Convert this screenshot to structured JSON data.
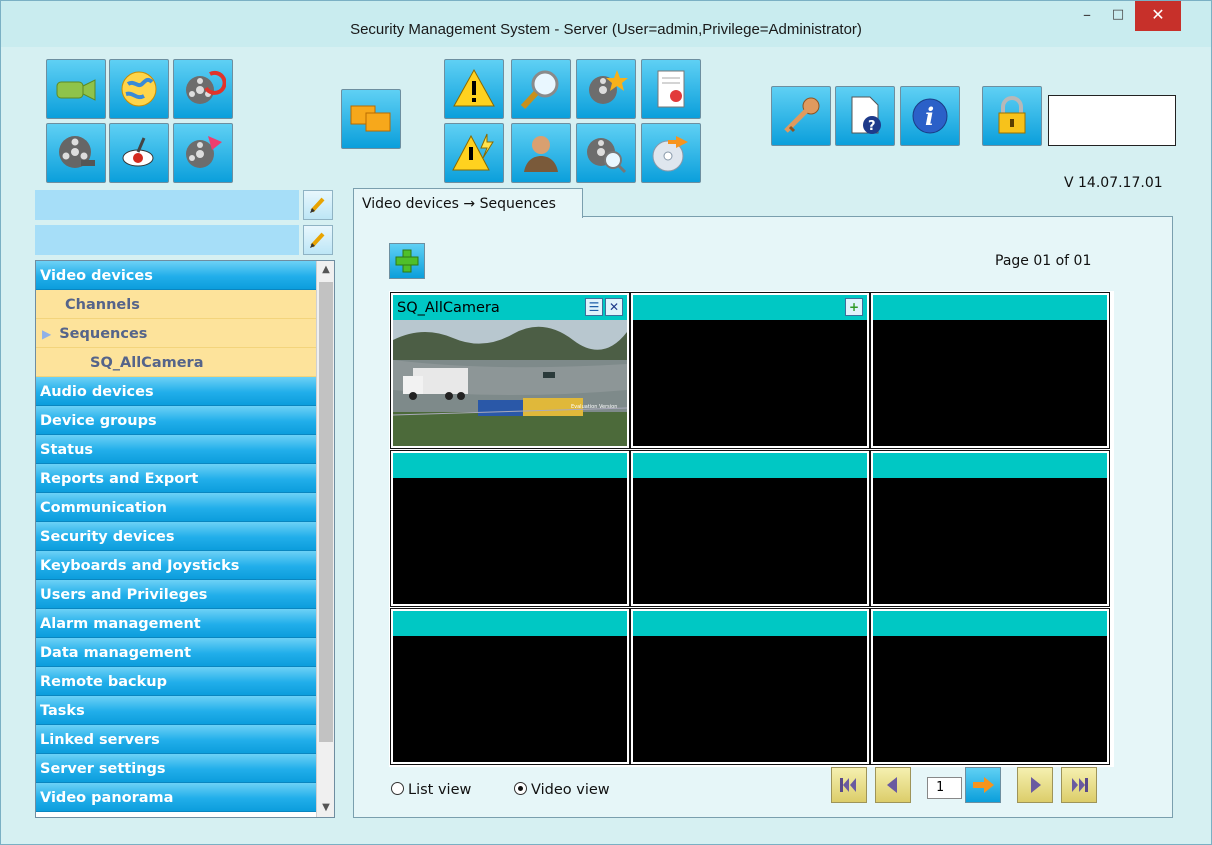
{
  "window": {
    "title": "Security Management System - Server (User=admin,Privilege=Administrator)",
    "controls": {
      "minimize": "–",
      "maximize": "□",
      "close": "✕"
    }
  },
  "toolbar": {
    "version": "V 14.07.17.01",
    "icons": [
      "video-camera-icon",
      "globe-icon",
      "film-refresh-icon",
      "film-reel-icon",
      "eye-icon",
      "film-export-icon",
      "windows-icon",
      "warning-icon",
      "magnifier-icon",
      "film-star-icon",
      "report-icon",
      "warning-flash-icon",
      "user-icon",
      "film-search-icon",
      "disc-export-icon",
      "key-icon",
      "help-document-icon",
      "info-icon",
      "lock-icon"
    ]
  },
  "sidebar": {
    "field1": "",
    "field2": "",
    "items": [
      {
        "label": "Video devices",
        "kind": "group"
      },
      {
        "label": "Channels",
        "kind": "sub"
      },
      {
        "label": "Sequences",
        "kind": "sub-selected"
      },
      {
        "label": "SQ_AllCamera",
        "kind": "subsub"
      },
      {
        "label": "Audio devices",
        "kind": "group"
      },
      {
        "label": "Device groups",
        "kind": "group"
      },
      {
        "label": "Status",
        "kind": "group"
      },
      {
        "label": "Reports and Export",
        "kind": "group"
      },
      {
        "label": "Communication",
        "kind": "group"
      },
      {
        "label": "Security devices",
        "kind": "group"
      },
      {
        "label": "Keyboards and Joysticks",
        "kind": "group"
      },
      {
        "label": "Users and Privileges",
        "kind": "group"
      },
      {
        "label": "Alarm management",
        "kind": "group"
      },
      {
        "label": "Data management",
        "kind": "group"
      },
      {
        "label": "Remote backup",
        "kind": "group"
      },
      {
        "label": "Tasks",
        "kind": "group"
      },
      {
        "label": "Linked servers",
        "kind": "group"
      },
      {
        "label": "Server settings",
        "kind": "group"
      },
      {
        "label": "Video panorama",
        "kind": "group"
      }
    ]
  },
  "tab": {
    "label": "Video devices → Sequences"
  },
  "main": {
    "page_label": "Page 01 of 01",
    "cells": [
      {
        "title": "SQ_AllCamera",
        "watermark": "Evaluation Version"
      },
      {
        "title": ""
      },
      {
        "title": ""
      },
      {
        "title": ""
      },
      {
        "title": ""
      },
      {
        "title": ""
      },
      {
        "title": ""
      },
      {
        "title": ""
      },
      {
        "title": ""
      }
    ],
    "view_options": {
      "list": "List view",
      "video": "Video view",
      "selected": "video"
    },
    "pager": {
      "current": "1"
    }
  },
  "colors": {
    "accent": "#0ea5e3",
    "cell_header": "#00c8c4",
    "sub_item_bg": "#fde39b",
    "window_bg": "#d6f0f2"
  }
}
